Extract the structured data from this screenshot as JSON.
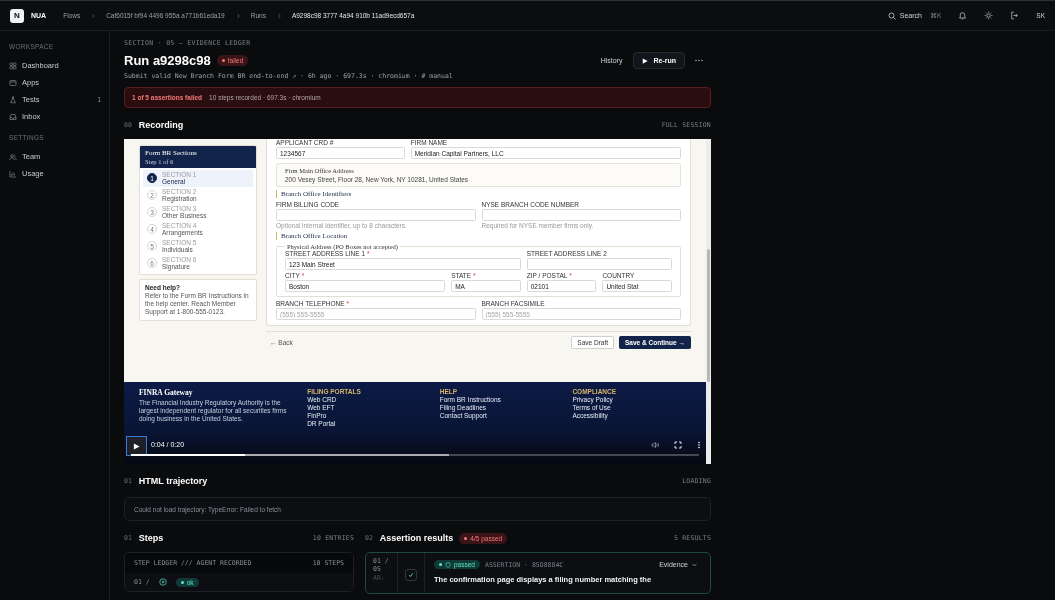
{
  "topbar": {
    "logo": "N",
    "brand": "NUA",
    "breadcrumbs": [
      {
        "label": "Flows",
        "current": false
      },
      {
        "label": "Caf6015f bf94 4496 955a a771b61eda19",
        "current": false
      },
      {
        "label": "Runs",
        "current": false
      },
      {
        "label": "A9298c98 3777 4a94 910b 11ad9ecd657a",
        "current": true
      }
    ],
    "search": {
      "label": "Search",
      "shortcut": "⌘K"
    },
    "avatar": "SK"
  },
  "sidebar": {
    "groups": [
      {
        "heading": "WORKSPACE",
        "items": [
          {
            "kind": "dashboard",
            "label": "Dashboard"
          },
          {
            "kind": "apps",
            "label": "Apps"
          },
          {
            "kind": "tests",
            "label": "Tests",
            "count": "1"
          },
          {
            "kind": "inbox",
            "label": "Inbox"
          }
        ]
      },
      {
        "heading": "SETTINGS",
        "items": [
          {
            "kind": "team",
            "label": "Team"
          },
          {
            "kind": "usage",
            "label": "Usage"
          }
        ]
      }
    ]
  },
  "header": {
    "eyebrow": "SECTION · 05 — EVIDENCE LEDGER",
    "title": "Run a9298c98",
    "status": "failed",
    "meta": "Submit valid New Branch Form BR end-to-end ↗ · 6h ago · 697.3s · chromium · # manual",
    "history": "History",
    "rerun": "Re-run"
  },
  "alert": {
    "title": "1 of 5 assertions failed",
    "detail": "10 steps recorded · 697.3s · chromium"
  },
  "recording": {
    "index": "00",
    "title": "Recording",
    "tag": "FULL SESSION",
    "page": {
      "nav": {
        "title": "Form BR Sections",
        "subtitle": "Step 1 of 6",
        "steps": [
          {
            "number": "1",
            "section": "SECTION 1",
            "name": "General",
            "selected": true
          },
          {
            "number": "2",
            "section": "SECTION 2",
            "name": "Registration",
            "selected": false
          },
          {
            "number": "3",
            "section": "SECTION 3",
            "name": "Other Business",
            "selected": false
          },
          {
            "number": "4",
            "section": "SECTION 4",
            "name": "Arrangements",
            "selected": false
          },
          {
            "number": "5",
            "section": "SECTION 5",
            "name": "Individuals",
            "selected": false
          },
          {
            "number": "6",
            "section": "SECTION 6",
            "name": "Signature",
            "selected": false
          }
        ]
      },
      "help": {
        "title": "Need help?",
        "text": "Refer to the Form BR Instructions in the help center. Reach Member Support at 1-800-555-0123."
      },
      "form": [
        {
          "kind": "fields",
          "fields": [
            {
              "label": "APPLICANT CRD #",
              "value": "1234567"
            },
            {
              "label": "FIRM NAME",
              "value": "Meridian Capital Partners, LLC"
            }
          ]
        },
        {
          "kind": "address",
          "title": "Firm Main Office Address",
          "text": "200 Vesey Street, Floor 28, New York, NY 10281, United States"
        },
        {
          "kind": "heading",
          "text": "Branch Office Identifiers"
        },
        {
          "kind": "fields",
          "fields": [
            {
              "label": "FIRM BILLING CODE",
              "hint": "Optional internal identifier, up to 8 characters."
            },
            {
              "label": "NYSE BRANCH CODE NUMBER",
              "hint": "Required for NYSE member firms only."
            }
          ]
        },
        {
          "kind": "heading",
          "text": "Branch Office Location"
        },
        {
          "kind": "fieldset",
          "legend": "Physical Address (PO Boxes not accepted)",
          "fields": [
            {
              "label": "STREET ADDRESS LINE 1",
              "mark": "*",
              "value": "123 Main Street"
            },
            {
              "label": "STREET ADDRESS LINE 2"
            },
            {
              "label": "CITY",
              "mark": "*",
              "value": "Boston"
            },
            {
              "label": "STATE",
              "mark": "*",
              "value": "MA"
            },
            {
              "label": "ZIP / POSTAL",
              "mark": "*",
              "value": "02101"
            },
            {
              "label": "COUNTRY",
              "value": "United Stat"
            }
          ]
        },
        {
          "kind": "fields",
          "fields": [
            {
              "label": "BRANCH TELEPHONE",
              "mark": "*",
              "placeholder": "(555) 555-5555"
            },
            {
              "label": "BRANCH FACSIMILE",
              "placeholder": "(555) 555-5555"
            }
          ]
        }
      ],
      "actions": {
        "back": "← Back",
        "draft": "Save Draft",
        "continue": "Save & Continue →"
      },
      "footer": {
        "brand": "FINRA Gateway",
        "about": "The Financial Industry Regulatory Authority is the largest independent regulator for all securities firms doing business in the United States.",
        "columns": [
          {
            "heading": "FILING PORTALS",
            "links": [
              "Web CRD",
              "Web EFT",
              "FinPro",
              "DR Portal"
            ]
          },
          {
            "heading": "HELP",
            "links": [
              "Form BR Instructions",
              "Filing Deadlines",
              "Contact Support"
            ]
          },
          {
            "heading": "COMPLIANCE",
            "links": [
              "Privacy Policy",
              "Terms of Use",
              "Accessibility"
            ]
          }
        ]
      }
    },
    "player": {
      "time": "0:04 / 0:20",
      "progress": {
        "level": 0.2
      },
      "buffer": {
        "level": 0.56
      }
    }
  },
  "trajectory": {
    "index": "01",
    "title": "HTML trajectory",
    "tag": "LOADING",
    "error": "Could not load trajectory: TypeError: Failed to fetch"
  },
  "steps": {
    "index": "01",
    "title": "Steps",
    "tag": "10 ENTRIES",
    "ledger": {
      "title": "STEP LEDGER /// AGENT RECORDED",
      "count": "10 STEPS"
    },
    "rows": [
      {
        "number": "01 /",
        "status": "ok"
      }
    ]
  },
  "assertions": {
    "index": "02",
    "title": "Assertion results",
    "badge": "4/5 passed",
    "tag": "5 RESULTS",
    "items": [
      {
        "number": "01 / 05",
        "prefix": "AR-",
        "checked": true,
        "status": "passed",
        "meta": "ASSERTION · 85D8884C",
        "action": "Evidence",
        "text": "The confirmation page displays a filing number matching the"
      }
    ]
  }
}
